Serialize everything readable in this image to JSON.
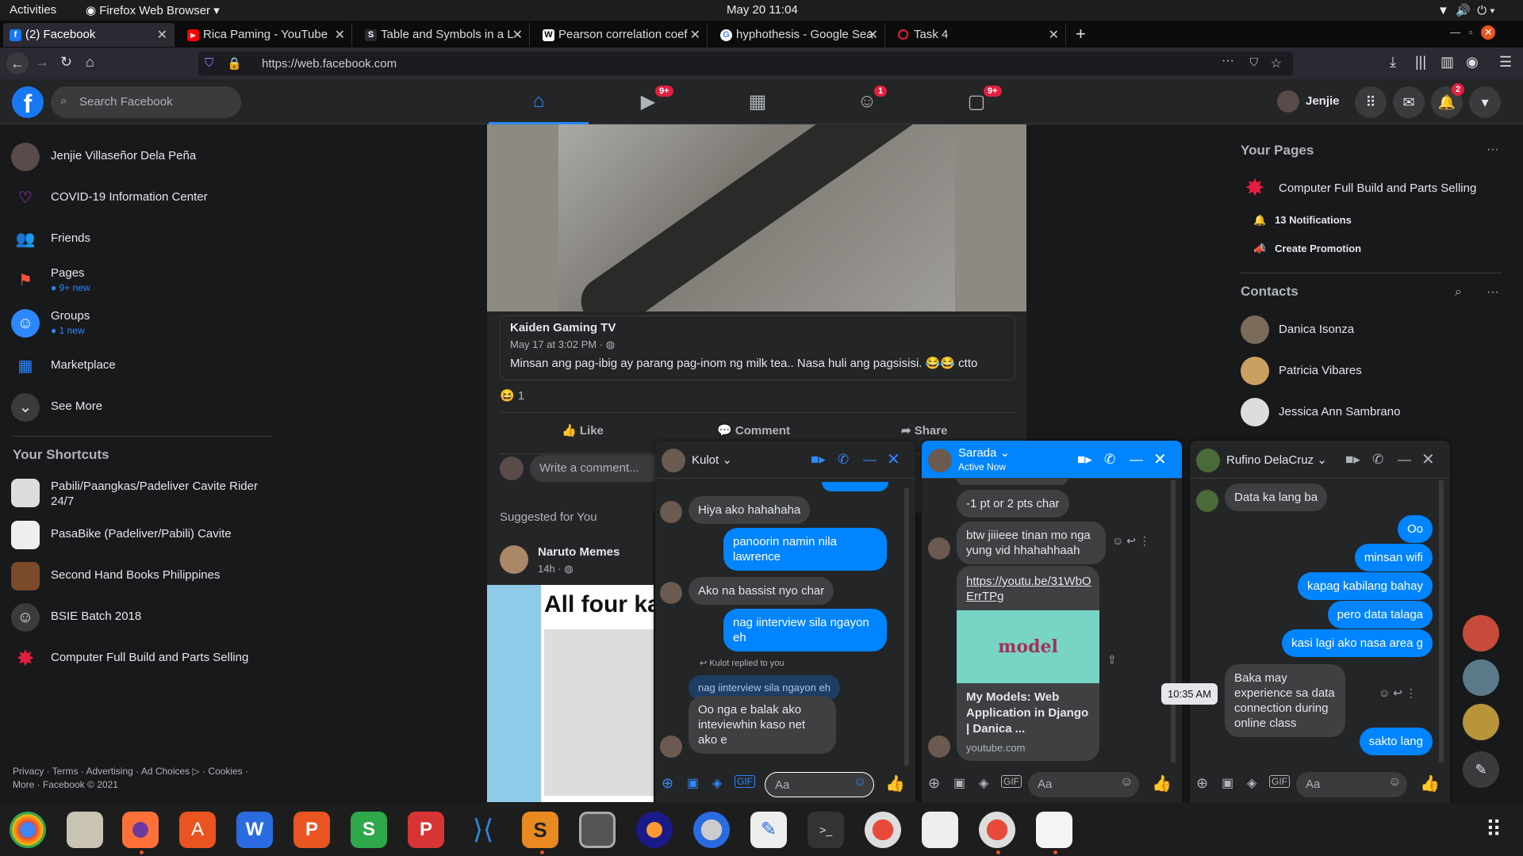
{
  "system": {
    "activities": "Activities",
    "app": "Firefox Web Browser",
    "clock": "May 20  11:04"
  },
  "tabs": [
    {
      "label": "(2) Facebook",
      "fav": "f",
      "color": "#1877f2"
    },
    {
      "label": "Rica Paming - YouTube",
      "fav": "▶",
      "color": "#ff0000"
    },
    {
      "label": "Table and Symbols in a L",
      "fav": "S",
      "color": "#1c1b22"
    },
    {
      "label": "Pearson correlation coef",
      "fav": "W",
      "color": "#ffffff"
    },
    {
      "label": "hyphothesis - Google Sea",
      "fav": "G",
      "color": "#ffffff"
    },
    {
      "label": "Task 4",
      "fav": "◌",
      "color": "#2b2a33"
    }
  ],
  "url": "https://web.facebook.com",
  "fb": {
    "search_placeholder": "Search Facebook",
    "user_short": "Jenjie",
    "badges": {
      "watch": "9+",
      "groups": "1",
      "gaming": "9+",
      "notifications": "2"
    }
  },
  "left_nav": [
    {
      "label": "Jenjie Villaseñor Dela Peña",
      "sub": ""
    },
    {
      "label": "COVID-19 Information Center",
      "sub": ""
    },
    {
      "label": "Friends",
      "sub": ""
    },
    {
      "label": "Pages",
      "sub": "9+ new"
    },
    {
      "label": "Groups",
      "sub": "1 new"
    },
    {
      "label": "Marketplace",
      "sub": ""
    },
    {
      "label": "See More",
      "sub": ""
    }
  ],
  "shortcuts_title": "Your Shortcuts",
  "shortcuts": [
    "Pabili/Paangkas/Padeliver Cavite Rider 24/7",
    "PasaBike (Padeliver/Pabili) Cavite",
    "Second Hand Books Philippines",
    "BSIE Batch 2018",
    "Computer Full Build and Parts Selling"
  ],
  "footer": {
    "line1": "Privacy · Terms · Advertising · Ad Choices ▷ · Cookies ·",
    "line2": "More · Facebook © 2021"
  },
  "post": {
    "author": "Kaiden Gaming TV",
    "time": "May 17 at 3:02 PM ·",
    "text": "Minsan ang pag-ibig ay parang pag-inom ng milk tea.. Nasa huli ang pagsisisi. 😂😂 ctto",
    "reactions": "1",
    "like": "Like",
    "comment": "Comment",
    "share": "Share",
    "comment_placeholder": "Write a comment..."
  },
  "suggested": {
    "title": "Suggested for You",
    "page": "Naruto Memes",
    "time": "14h ·",
    "image_text": "All four kar"
  },
  "right": {
    "pages_title": "Your Pages",
    "page_name": "Computer Full Build and Parts Selling",
    "notifications": "13 Notifications",
    "promotion": "Create Promotion",
    "contacts_title": "Contacts",
    "contacts": [
      "Danica Isonza",
      "Patricia Vibares",
      "Jessica Ann Sambrano"
    ]
  },
  "chat1": {
    "name": "Kulot",
    "messages": [
      {
        "dir": "in",
        "text": "Hiya ako hahahaha"
      },
      {
        "dir": "out",
        "text": "panoorin namin nila lawrence"
      },
      {
        "dir": "in",
        "text": "Ako na bassist nyo char"
      },
      {
        "dir": "out",
        "text": "nag iinterview sila ngayon eh"
      },
      {
        "dir": "in",
        "text": "Oo nga e balak ako inteviewhin kaso net ako e"
      }
    ],
    "reply_note": "Kulot replied to you",
    "reply_quote": "nag iinterview sila ngayon eh",
    "input": "Aa"
  },
  "chat2": {
    "name": "Sarada",
    "status": "Active Now",
    "messages": [
      {
        "dir": "in",
        "text": "-1 pt or 2 pts char"
      },
      {
        "dir": "in",
        "text": "btw jiiieee tinan mo nga yung vid hhahahhaah"
      }
    ],
    "link": "https://youtu.be/31WbOErrTPg",
    "link_image": "model",
    "link_title": "My Models: Web Application in Django | Danica ...",
    "link_domain": "youtube.com",
    "input": "Aa"
  },
  "chat3": {
    "name": "Rufino DelaCruz",
    "messages": [
      {
        "dir": "in",
        "text": "Data ka lang ba"
      },
      {
        "dir": "out",
        "text": "Oo"
      },
      {
        "dir": "out",
        "text": "minsan wifi"
      },
      {
        "dir": "out",
        "text": "kapag kabilang bahay"
      },
      {
        "dir": "out",
        "text": "pero data talaga"
      },
      {
        "dir": "out",
        "text": "kasi lagi ako nasa area g"
      },
      {
        "dir": "in",
        "text": "Baka may experience sa data connection during online class"
      },
      {
        "dir": "out",
        "text": "sakto lang"
      }
    ],
    "tooltip": "10:35 AM",
    "input": "Aa"
  }
}
